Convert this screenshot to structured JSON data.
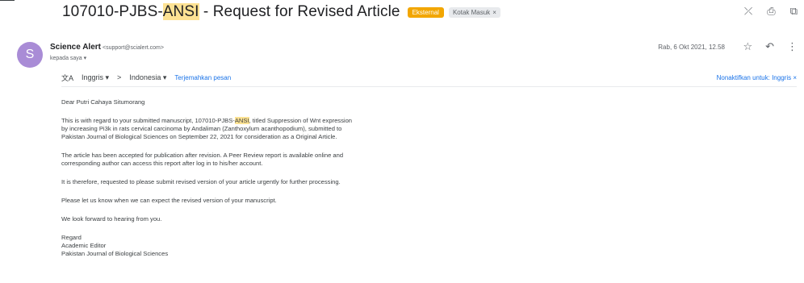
{
  "subject": {
    "prefix": "107010-PJBS-",
    "highlight": "ANSI",
    "suffix": " - Request for Revised Article"
  },
  "labels": {
    "external": "Eksternal",
    "inbox": "Kotak Masuk",
    "inbox_remove": "×"
  },
  "header_icons": [
    "collapse-icon",
    "print-icon",
    "open-in-new-icon"
  ],
  "sender": {
    "avatar_letter": "S",
    "name": "Science Alert",
    "email": "<support@scialert.com>",
    "recipient": "kepada saya ▾",
    "date": "Rab, 6 Okt 2021, 12.58",
    "star": "☆",
    "reply": "↶",
    "more": "⋮"
  },
  "translate": {
    "icon": "文A",
    "from": "Inggris ▾",
    "arrow": ">",
    "to": "Indonesia ▾",
    "link": "Terjemahkan pesan",
    "disable": "Nonaktifkan untuk: Inggris",
    "close": "×"
  },
  "body": {
    "greeting": "Dear Putri Cahaya Situmorang",
    "p1_before": "This is with regard to your submitted manuscript, 107010-PJBS-",
    "p1_highlight": "ANSI",
    "p1_line1_end": ", titled Suppression of Wnt expression",
    "p1_line2": "by increasing Pi3k in rats cervical carcinoma by Andaliman (Zanthoxylum acanthopodium), submitted to",
    "p1_line3": "Pakistan Journal of Biological Sciences on September 22, 2021 for consideration as a Original Article.",
    "p2_line1": "The article has been accepted for publication after revision. A Peer Review report is available online and",
    "p2_line2": "corresponding author can access this report after log in to his/her account.",
    "p3": "It is therefore, requested to please submit revised version of your article urgently for further processing.",
    "p4": "Please let us know when we can expect the revised version of your manuscript.",
    "p5": "We look forward to hearing from you.",
    "sig1": "Regard",
    "sig2": "Academic Editor",
    "sig3": "Pakistan Journal of Biological Sciences"
  }
}
